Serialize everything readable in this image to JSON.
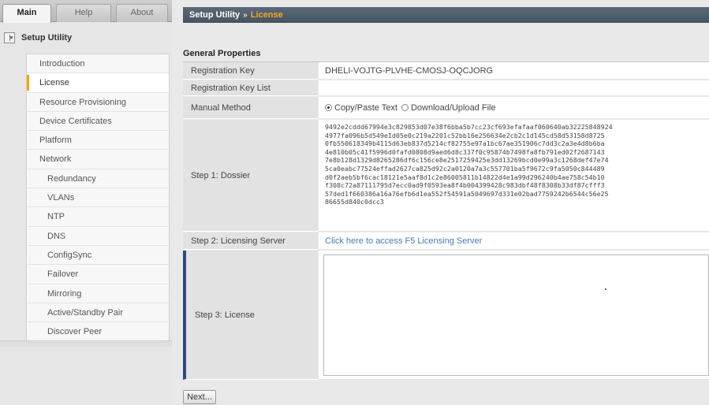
{
  "tabs": [
    {
      "label": "Main"
    },
    {
      "label": "Help"
    },
    {
      "label": "About"
    }
  ],
  "sidebar": {
    "title": "Setup Utility",
    "items": [
      {
        "label": "Introduction"
      },
      {
        "label": "License"
      },
      {
        "label": "Resource Provisioning"
      },
      {
        "label": "Device Certificates"
      },
      {
        "label": "Platform"
      },
      {
        "label": "Network"
      },
      {
        "label": "Redundancy"
      },
      {
        "label": "VLANs"
      },
      {
        "label": "NTP"
      },
      {
        "label": "DNS"
      },
      {
        "label": "ConfigSync"
      },
      {
        "label": "Failover"
      },
      {
        "label": "Mirroring"
      },
      {
        "label": "Active/Standby Pair"
      },
      {
        "label": "Discover Peer"
      }
    ]
  },
  "breadcrumb": {
    "root": "Setup Utility",
    "separator": "»",
    "current": "License"
  },
  "section_title": "General Properties",
  "rows": {
    "registration_key": {
      "label": "Registration Key",
      "value": "DHELI-VOJTG-PLVHE-CMOSJ-OQCJORG"
    },
    "registration_key_list": {
      "label": "Registration Key List",
      "value": ""
    },
    "manual_method": {
      "label": "Manual Method",
      "option_copy": "Copy/Paste Text",
      "option_download": "Download/Upload File"
    },
    "dossier": {
      "label": "Step 1: Dossier",
      "lines": [
        "9492e2cddd67994e3c829853d07e38f6bba5b7cc23cf693efafaaf060640ab32225848924",
        "4977fa096b5d549e1d05e0c219a2201c52bb16e256634e2cb2c1d145cd58d53158d8725",
        "0fb550618349b4115d63eb837d5214cf82755e97a1bc67ae351906c7dd3c2a3e4d8b6ba",
        "4e810b05c41f5996d0fafd0808d9aed6d8c337f0c95874b7498fa8fb791ed02f2687143",
        "7e8b128d1329d8265286df6c156ce8e2517259425e3dd13269bcd0e99a3c1268def47e74",
        "5ca0eabc77524effad2627ca825d92c2a0120a7a3c557701ba5f9672c9fa5050c844489",
        "d0f2aeb5bf6cac18121e5aaf8d1c2e86005811b14822d4e1a99d296240b4ae758c54b10",
        "f308c72a87111795d7ecc0ad9f0593ea8f4b004399428c983dbf48f8308b33df87cfff3",
        "57ded1f660386a16a76efb6d1ea552f54591a5049697d331e02bad7759242b6544c56e25",
        "86655d840c0dcc3"
      ]
    },
    "licensing_server": {
      "label": "Step 2: Licensing Server",
      "link": "Click here to access F5 Licensing Server"
    },
    "license": {
      "label": "Step 3: License",
      "value": ""
    }
  },
  "next_button": "Next...",
  "colors": {
    "titlebar": "#4f5c6b",
    "breadcrumb_current": "#f5a623",
    "active_marker": "#f0a500",
    "link": "#4a78b5"
  }
}
